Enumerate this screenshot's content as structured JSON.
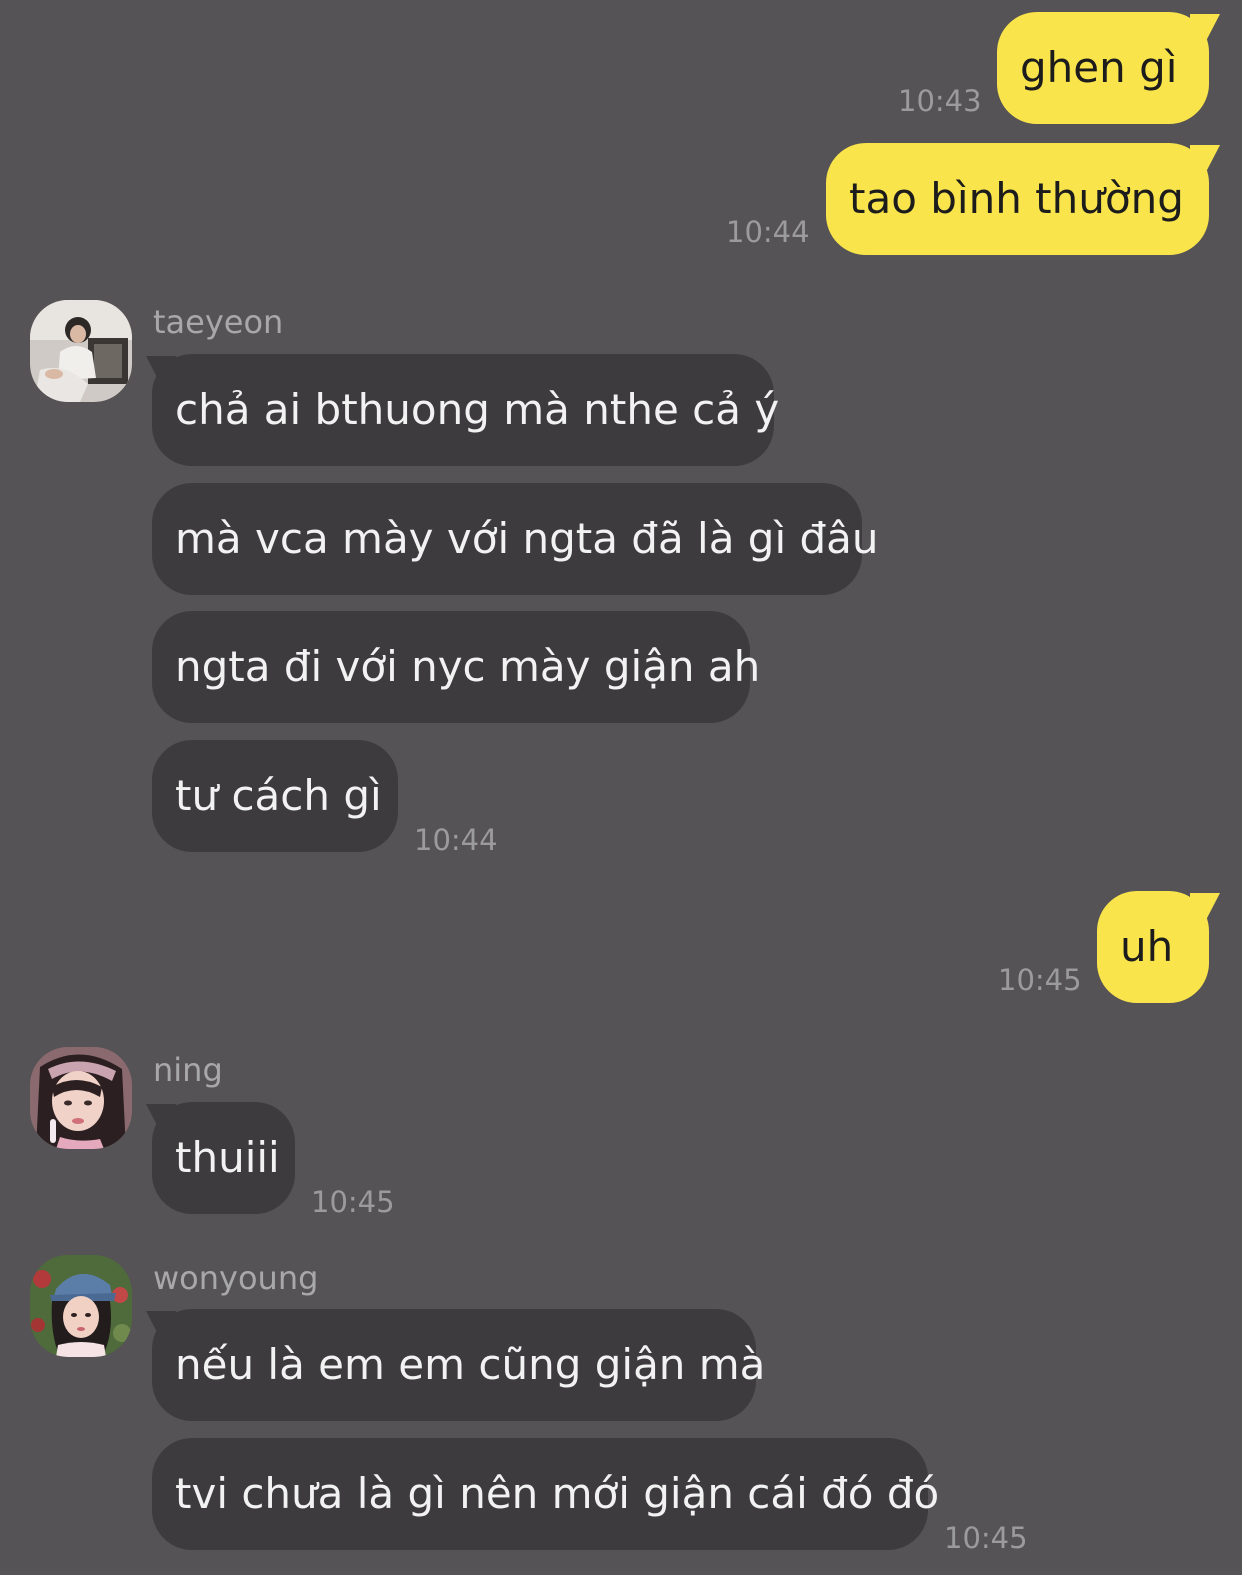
{
  "colors": {
    "background": "#555355",
    "outgoing_bubble": "#f9e44b",
    "incoming_bubble": "#3d3b3e",
    "timestamp": "#9b9a9c"
  },
  "outgoing": [
    {
      "text": "ghen gì",
      "time": "10:43"
    },
    {
      "text": "tao bình thường",
      "time": "10:44"
    },
    {
      "text": "uh",
      "time": "10:45"
    }
  ],
  "groups": [
    {
      "sender": "taeyeon",
      "avatar_icon": "taeyeon-avatar-icon",
      "messages": [
        "chả ai bthuong mà nthe cả ý",
        "mà vca mày với ngta đã là gì đâu",
        "ngta đi với nyc mày giận ah",
        "tư cách gì"
      ],
      "time": "10:44"
    },
    {
      "sender": "ning",
      "avatar_icon": "ning-avatar-icon",
      "messages": [
        "thuiii"
      ],
      "time": "10:45"
    },
    {
      "sender": "wonyoung",
      "avatar_icon": "wonyoung-avatar-icon",
      "messages": [
        "nếu là em em cũng giận mà",
        "tvi chưa là gì nên mới giận cái đó đó"
      ],
      "time": "10:45"
    }
  ]
}
